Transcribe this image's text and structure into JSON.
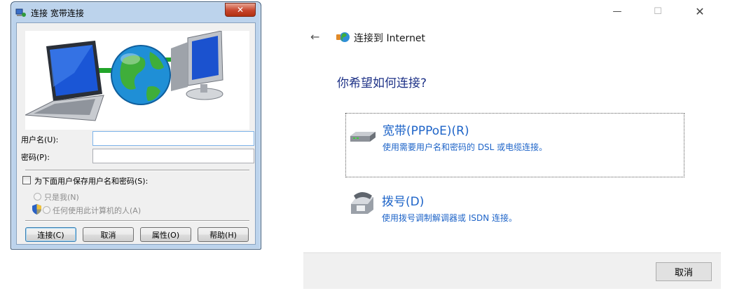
{
  "win7": {
    "title": "连接 宽带连接",
    "close_glyph": "✕",
    "username_label": "用户名(U):",
    "username_value": "",
    "password_label": "密码(P):",
    "password_value": "",
    "save_credentials_label": "为下面用户保存用户名和密码(S):",
    "save_credentials_checked": false,
    "radio_me_only": "只是我(N)",
    "radio_anyone": "任何使用此计算机的人(A)",
    "buttons": {
      "connect": "连接(C)",
      "cancel": "取消",
      "properties": "属性(O)",
      "help": "帮助(H)"
    }
  },
  "win10": {
    "caption": {
      "minimize": "—",
      "maximize": "☐",
      "close": "✕"
    },
    "back_glyph": "←",
    "title": "连接到 Internet",
    "heading": "你希望如何连接?",
    "options": [
      {
        "title": "宽带(PPPoE)(R)",
        "desc": "使用需要用户名和密码的 DSL 或电缆连接。",
        "icon": "modem-icon"
      },
      {
        "title": "拨号(D)",
        "desc": "使用拨号调制解调器或 ISDN 连接。",
        "icon": "phone-icon"
      }
    ],
    "cancel_label": "取消"
  }
}
